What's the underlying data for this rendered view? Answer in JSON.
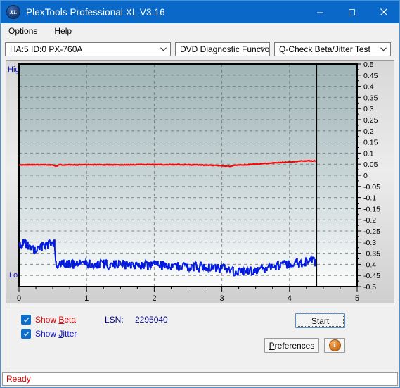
{
  "window": {
    "title": "PlexTools Professional XL V3.16",
    "icon": "xl-logo-icon",
    "minimize_label": "minimize-icon",
    "maximize_label": "maximize-icon",
    "close_label": "close-icon"
  },
  "menubar": {
    "items": [
      {
        "label": "Options",
        "accel": "O"
      },
      {
        "label": "Help",
        "accel": "H"
      }
    ]
  },
  "toolbar": {
    "drive_select": "HA:5 ID:0  PX-760A",
    "function_select": "DVD Diagnostic Functions",
    "test_select": "Q-Check Beta/Jitter Test"
  },
  "chart_labels": {
    "high": "High",
    "low": "Low"
  },
  "controls": {
    "show_beta": {
      "label": "Show Beta",
      "accel": "B",
      "checked": true
    },
    "show_jitter": {
      "label": "Show Jitter",
      "accel": "J",
      "checked": true
    },
    "lsn_label": "LSN:",
    "lsn_value": "2295040",
    "start_button": {
      "label": "Start",
      "accel": "S"
    },
    "preferences_button": {
      "label": "Preferences",
      "accel": "P"
    },
    "info_button": {
      "label": "i"
    }
  },
  "statusbar": {
    "text": "Ready"
  },
  "colors": {
    "titlebar": "#0a69c8",
    "beta_curve": "#ff0000",
    "jitter_curve": "#0018e0",
    "accent_blue": "#1111cc",
    "status_text": "#e00000",
    "plot_top": "#9fb3b5",
    "plot_bottom": "#fbfcfc"
  },
  "chart_data": {
    "type": "line",
    "title": "",
    "xlabel": "",
    "ylabel": "",
    "xlim": [
      0,
      5
    ],
    "ylim": [
      -0.5,
      0.5
    ],
    "xticks": [
      0,
      1,
      2,
      3,
      4,
      5
    ],
    "yticks": [
      0.5,
      0.45,
      0.4,
      0.35,
      0.3,
      0.25,
      0.2,
      0.15,
      0.1,
      0.05,
      0,
      -0.05,
      -0.1,
      -0.15,
      -0.2,
      -0.25,
      -0.3,
      -0.35,
      -0.4,
      -0.45,
      -0.5
    ],
    "grid": true,
    "legend_position": "below-left",
    "cursor_x": 4.4,
    "data_end_x": 4.4,
    "series": [
      {
        "name": "Show Beta",
        "color": "#ff0000",
        "x": [
          0.0,
          0.1,
          0.2,
          0.3,
          0.4,
          0.5,
          0.55,
          0.6,
          0.7,
          0.8,
          0.9,
          1.0,
          1.2,
          1.4,
          1.6,
          1.8,
          2.0,
          2.2,
          2.4,
          2.6,
          2.8,
          3.0,
          3.1,
          3.15,
          3.2,
          3.3,
          3.4,
          3.5,
          3.6,
          3.7,
          3.8,
          3.9,
          4.0,
          4.1,
          4.2,
          4.3,
          4.4
        ],
        "y": [
          0.047,
          0.047,
          0.047,
          0.047,
          0.047,
          0.047,
          0.04,
          0.047,
          0.047,
          0.047,
          0.047,
          0.047,
          0.047,
          0.047,
          0.047,
          0.048,
          0.048,
          0.048,
          0.048,
          0.047,
          0.045,
          0.043,
          0.042,
          0.041,
          0.046,
          0.047,
          0.048,
          0.05,
          0.052,
          0.054,
          0.056,
          0.058,
          0.06,
          0.062,
          0.064,
          0.065,
          0.065
        ],
        "noise": 0.002
      },
      {
        "name": "Show Jitter",
        "color": "#0018e0",
        "x": [
          0.0,
          0.05,
          0.1,
          0.15,
          0.2,
          0.25,
          0.3,
          0.35,
          0.4,
          0.45,
          0.5,
          0.52,
          0.55,
          0.6,
          0.7,
          0.8,
          0.9,
          1.0,
          1.2,
          1.4,
          1.6,
          1.8,
          2.0,
          2.2,
          2.4,
          2.6,
          2.8,
          3.0,
          3.1,
          3.2,
          3.3,
          3.4,
          3.5,
          3.6,
          3.7,
          3.8,
          3.9,
          4.0,
          4.1,
          4.2,
          4.3,
          4.4
        ],
        "y": [
          -0.315,
          -0.305,
          -0.31,
          -0.325,
          -0.335,
          -0.33,
          -0.32,
          -0.318,
          -0.312,
          -0.305,
          -0.305,
          -0.31,
          -0.395,
          -0.4,
          -0.4,
          -0.4,
          -0.4,
          -0.4,
          -0.4,
          -0.402,
          -0.402,
          -0.403,
          -0.405,
          -0.405,
          -0.408,
          -0.41,
          -0.412,
          -0.418,
          -0.428,
          -0.432,
          -0.43,
          -0.428,
          -0.425,
          -0.42,
          -0.415,
          -0.408,
          -0.402,
          -0.398,
          -0.393,
          -0.39,
          -0.388,
          -0.388
        ],
        "noise": 0.022
      }
    ]
  }
}
